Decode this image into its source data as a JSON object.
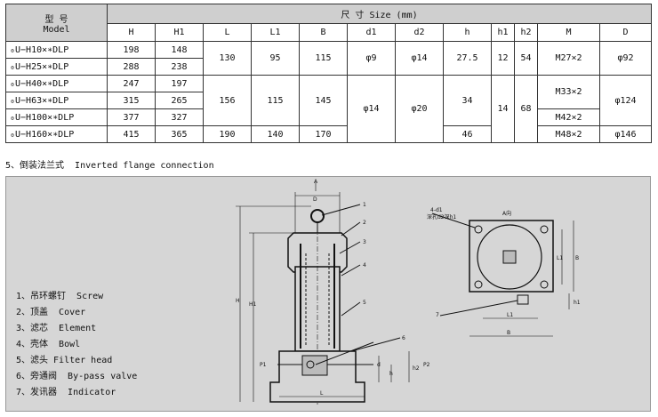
{
  "table": {
    "model_header": "型  号",
    "model_header_en": "Model",
    "size_header": "尺    寸 Size (mm)",
    "columns": [
      "H",
      "H1",
      "L",
      "L1",
      "B",
      "d1",
      "d2",
      "h",
      "h1",
      "h2",
      "M",
      "D"
    ],
    "rows": [
      {
        "model": "₀U−H10×∗DLP",
        "H": "198",
        "H1": "148"
      },
      {
        "model": "₀U−H25×∗DLP",
        "H": "288",
        "H1": "238"
      },
      {
        "model": "₀U−H40×∗DLP",
        "H": "247",
        "H1": "197"
      },
      {
        "model": "₀U−H63×∗DLP",
        "H": "315",
        "H1": "265"
      },
      {
        "model": "₀U−H100×∗DLP",
        "H": "377",
        "H1": "327"
      },
      {
        "model": "₀U−H160×∗DLP",
        "H": "415",
        "H1": "365"
      }
    ],
    "g1": {
      "L": "130",
      "L1": "95",
      "B": "115",
      "d1": "φ9",
      "d2": "φ14",
      "h": "27.5",
      "h1": "12",
      "h2": "54",
      "M": "M27×2",
      "D": "φ92"
    },
    "g2": {
      "L": "156",
      "L1": "115",
      "B": "145",
      "d1": "φ14",
      "d2": "φ20",
      "h": "34",
      "h1": "14",
      "h2": "68",
      "M1": "M33×2",
      "M2": "M42×2",
      "D": "φ124"
    },
    "g3": {
      "L": "190",
      "L1": "140",
      "B": "170",
      "h": "46",
      "M": "M48×2",
      "D": "φ146"
    }
  },
  "caption": "5、倒装法兰式  Inverted flange connection",
  "legend": [
    "1、吊环螺钉  Screw",
    "2、顶盖  Cover",
    "3、滤芯  Element",
    "4、壳体  Bowl",
    "5、滤头 Filter head",
    "6、旁通阀  By-pass valve",
    "7、发讯器  Indicator"
  ],
  "drawing": {
    "view_a": "A",
    "view_a_label": "A向",
    "dims": {
      "D": "D",
      "H": "H",
      "H1": "H1",
      "L": "L",
      "d": "d",
      "h": "h",
      "h2": "h2",
      "P1": "P1",
      "P2": "P2",
      "L1": "L1",
      "B": "B",
      "h1": "h1"
    },
    "hole_label": "4-d1",
    "hole_note": "深孔d2深h1",
    "callouts": [
      "1",
      "2",
      "3",
      "4",
      "5",
      "6",
      "7"
    ]
  }
}
